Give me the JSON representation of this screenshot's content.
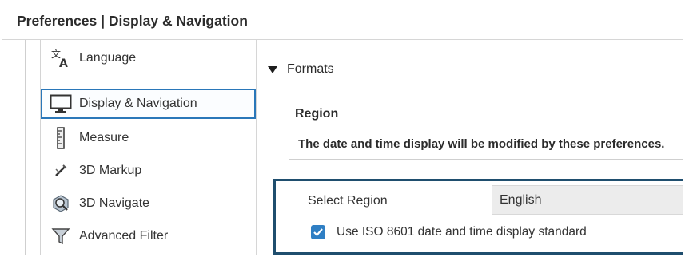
{
  "window": {
    "title": "Preferences | Display & Navigation"
  },
  "sidebar": {
    "items": [
      {
        "label": "Language",
        "icon": "language-icon"
      },
      {
        "label": "Display & Navigation",
        "icon": "monitor-icon",
        "selected": true
      },
      {
        "label": "Measure",
        "icon": "ruler-icon"
      },
      {
        "label": "3D Markup",
        "icon": "markup-pen-icon"
      },
      {
        "label": "3D Navigate",
        "icon": "navigate-icon"
      },
      {
        "label": "Advanced Filter",
        "icon": "filter-icon"
      }
    ]
  },
  "formats": {
    "section_label": "Formats",
    "expanded": true,
    "region_heading": "Region",
    "info_text": "The date and time display will be modified by these preferences.",
    "select_region_label": "Select Region",
    "select_region_value": "English",
    "iso_checkbox_label": "Use ISO 8601 date and time display standard",
    "iso_checked": true
  },
  "colors": {
    "selection_border": "#2a77b9",
    "panel_border": "#1f4e6e",
    "checkbox": "#2f7fc4"
  }
}
